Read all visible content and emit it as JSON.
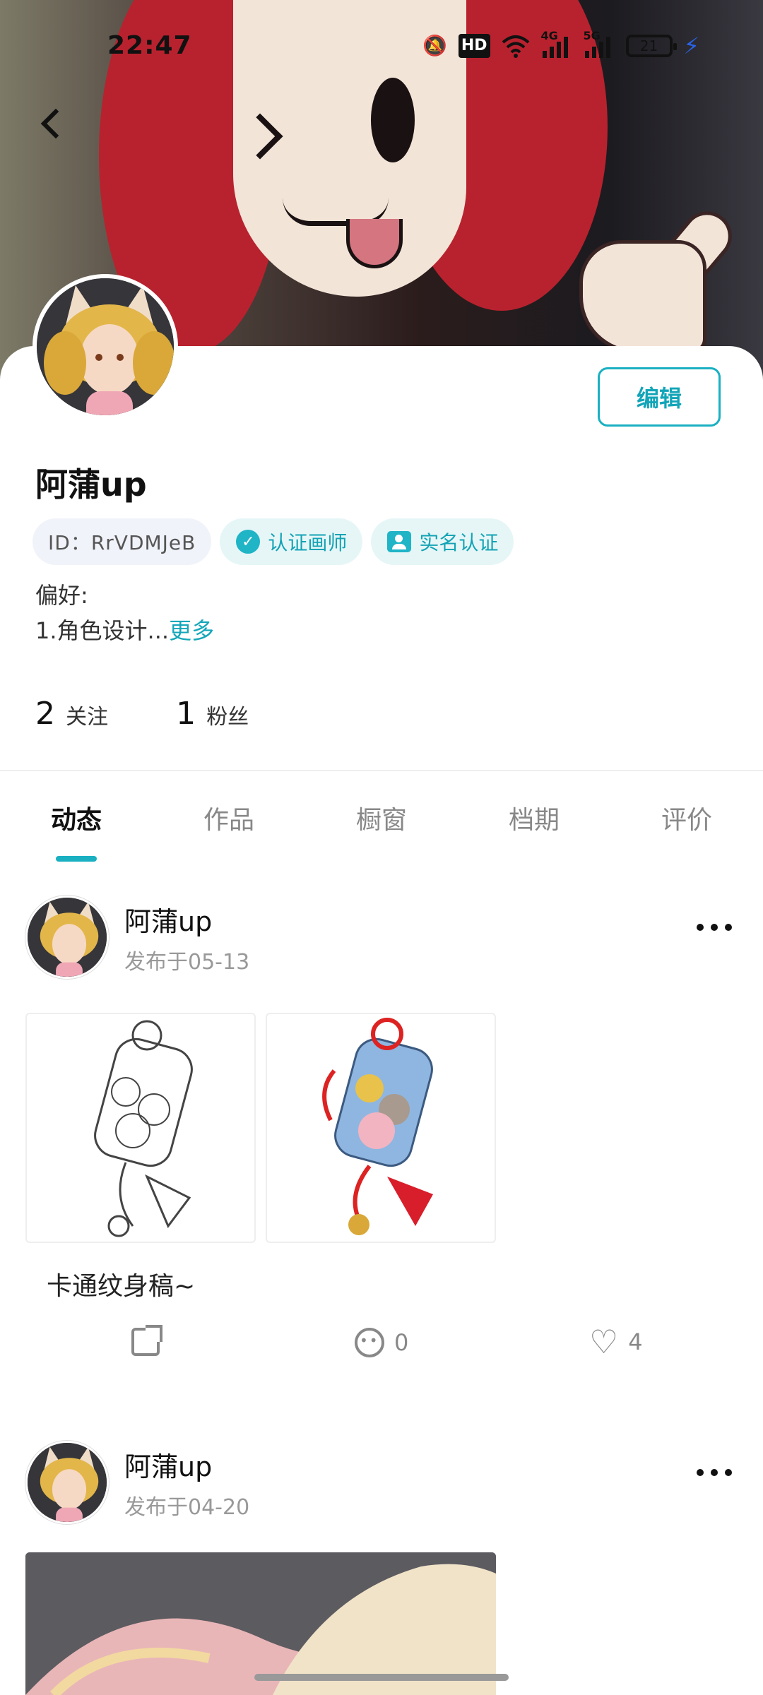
{
  "status_bar": {
    "time": "22:47",
    "mute_icon": "bell-off-icon",
    "hd_label": "HD",
    "wifi_icon": "wifi-icon",
    "signal1_label": "4G",
    "signal2_label": "5G",
    "battery": "21"
  },
  "profile": {
    "name": "阿蒲up",
    "edit_label": "编辑",
    "id_chip": "ID：RrVDMJeB",
    "cert_chip": "认证画师",
    "realname_chip": "实名认证",
    "pref_label": "偏好:",
    "pref_text": "1.角色设计...",
    "more_label": "更多",
    "following_count": "2",
    "following_label": "关注",
    "followers_count": "1",
    "followers_label": "粉丝"
  },
  "tabs": [
    {
      "label": "动态",
      "active": true
    },
    {
      "label": "作品",
      "active": false
    },
    {
      "label": "橱窗",
      "active": false
    },
    {
      "label": "档期",
      "active": false
    },
    {
      "label": "评价",
      "active": false
    }
  ],
  "posts": [
    {
      "author": "阿蒲up",
      "date": "发布于05-13",
      "caption": "卡通纹身稿~",
      "comments": "0",
      "likes": "4"
    },
    {
      "author": "阿蒲up",
      "date": "发布于04-20"
    }
  ],
  "colors": {
    "accent": "#1ab0c2"
  }
}
